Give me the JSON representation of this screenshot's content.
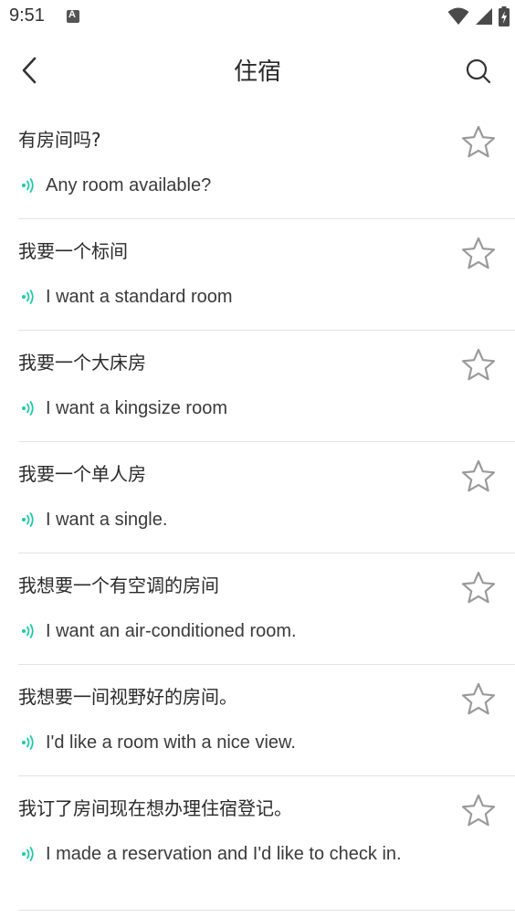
{
  "status_bar": {
    "time": "9:51",
    "icons": [
      "notification-a-icon",
      "wifi-icon",
      "signal-icon",
      "battery-charging-icon"
    ]
  },
  "app_bar": {
    "title": "住宿",
    "back_icon": "back-chevron-icon",
    "search_icon": "search-icon"
  },
  "colors": {
    "accent": "#1fc9a8",
    "star_outline": "#9a9a9a",
    "divider": "#e4e4e4",
    "text": "#2a2a2a"
  },
  "phrases": [
    {
      "chinese": "有房间吗?",
      "english": "Any room available?"
    },
    {
      "chinese": "我要一个标间",
      "english": "I want a standard room"
    },
    {
      "chinese": "我要一个大床房",
      "english": "I want a kingsize room"
    },
    {
      "chinese": "我要一个单人房",
      "english": "I want a single."
    },
    {
      "chinese": "我想要一个有空调的房间",
      "english": "I want an air-conditioned room."
    },
    {
      "chinese": "我想要一间视野好的房间。",
      "english": "I'd like a room with a nice view."
    },
    {
      "chinese": "我订了房间现在想办理住宿登记。",
      "english": "I made a reservation and I'd like to check in."
    }
  ]
}
